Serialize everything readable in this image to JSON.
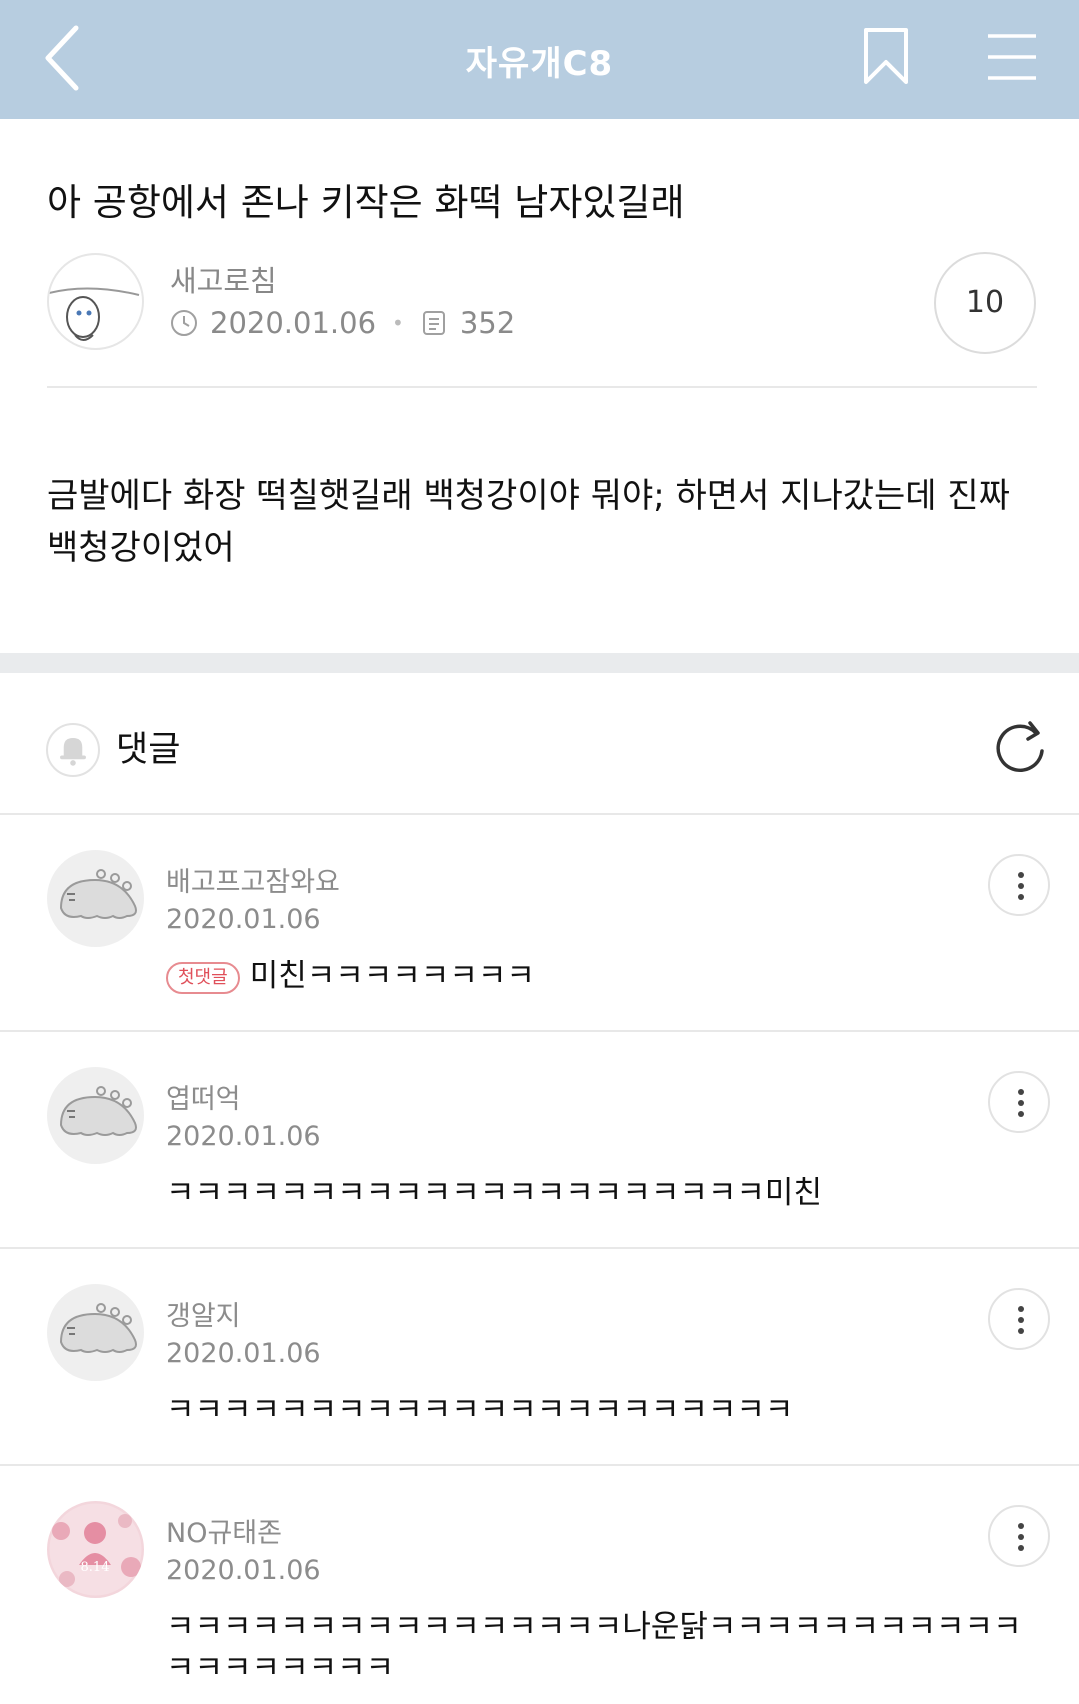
{
  "header": {
    "title": "자유개C8"
  },
  "post": {
    "title": "아 공항에서 존나 키작은 화떡 남자있길래",
    "author": "새고로침",
    "date": "2020.01.06",
    "views": "352",
    "comment_count": "10",
    "body": "금발에다 화장 떡칠햇길래 백청강이야 뭐야; 하면서 지나갔는데 진짜 백청강이었어"
  },
  "comments_section": {
    "label": "댓글"
  },
  "comments": [
    {
      "nick": "배고프고잠와요",
      "date": "2020.01.06",
      "badge": "첫댓글",
      "text": "미친ㅋㅋㅋㅋㅋㅋㅋㅋ"
    },
    {
      "nick": "엽떠억",
      "date": "2020.01.06",
      "text": "ㅋㅋㅋㅋㅋㅋㅋㅋㅋㅋㅋㅋㅋㅋㅋㅋㅋㅋㅋㅋㅋ미친"
    },
    {
      "nick": "갱알지",
      "date": "2020.01.06",
      "text": "ㅋㅋㅋㅋㅋㅋㅋㅋㅋㅋㅋㅋㅋㅋㅋㅋㅋㅋㅋㅋㅋㅋ"
    },
    {
      "nick": "NO규태존",
      "date": "2020.01.06",
      "text": "ㅋㅋㅋㅋㅋㅋㅋㅋㅋㅋㅋㅋㅋㅋㅋㅋ나운닭ㅋㅋㅋㅋㅋㅋㅋㅋㅋㅋㅋㅋㅋㅋㅋㅋㅋㅋㅋ"
    }
  ],
  "avatar_badge": {
    "date_text": "8.14"
  }
}
